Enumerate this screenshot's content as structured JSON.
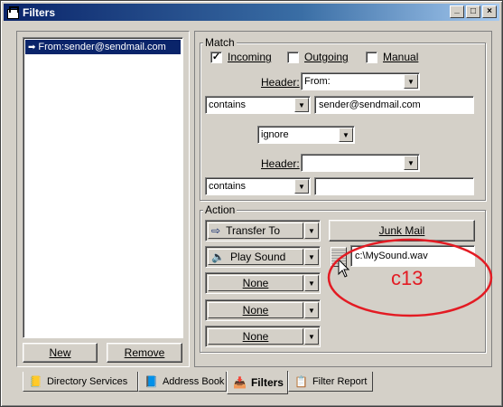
{
  "window": {
    "title": "Filters",
    "controls": {
      "minimize": "_",
      "maximize": "□",
      "close": "×"
    }
  },
  "filter_list": {
    "items": [
      {
        "label": "From:sender@sendmail.com",
        "selected": true
      }
    ],
    "new_label": "New",
    "remove_label": "Remove"
  },
  "match": {
    "group_label": "Match",
    "incoming": {
      "label": "Incoming",
      "checked": true,
      "mark": "✓"
    },
    "outgoing": {
      "label": "Outgoing",
      "checked": false
    },
    "manual": {
      "label": "Manual",
      "checked": false
    },
    "header1_label": "Header:",
    "header1_value": "From:",
    "condition1": "contains",
    "value1": "sender@sendmail.com",
    "logic": "ignore",
    "header2_label": "Header:",
    "header2_value": "",
    "condition2": "contains",
    "value2": ""
  },
  "action": {
    "group_label": "Action",
    "actions": [
      {
        "label": "Transfer To",
        "icon": "arrow-right-icon"
      },
      {
        "label": "Play Sound",
        "icon": "speaker-icon"
      },
      {
        "label": "None"
      },
      {
        "label": "None"
      },
      {
        "label": "None"
      }
    ],
    "junk_mail_label": "Junk Mail",
    "sound_path": "c:\\MySound.wav"
  },
  "annotation": {
    "label": "c13",
    "color": "#e31b23"
  },
  "tabs": [
    {
      "label": "Directory Services",
      "icon": "book-icon"
    },
    {
      "label": "Address Book",
      "icon": "address-book-icon"
    },
    {
      "label": "Filters",
      "icon": "filter-icon",
      "active": true
    },
    {
      "label": "Filter Report",
      "icon": "report-icon"
    }
  ],
  "colors": {
    "title_active": "#0a246a",
    "selection": "#0a246a",
    "face": "#d4d0c8"
  }
}
